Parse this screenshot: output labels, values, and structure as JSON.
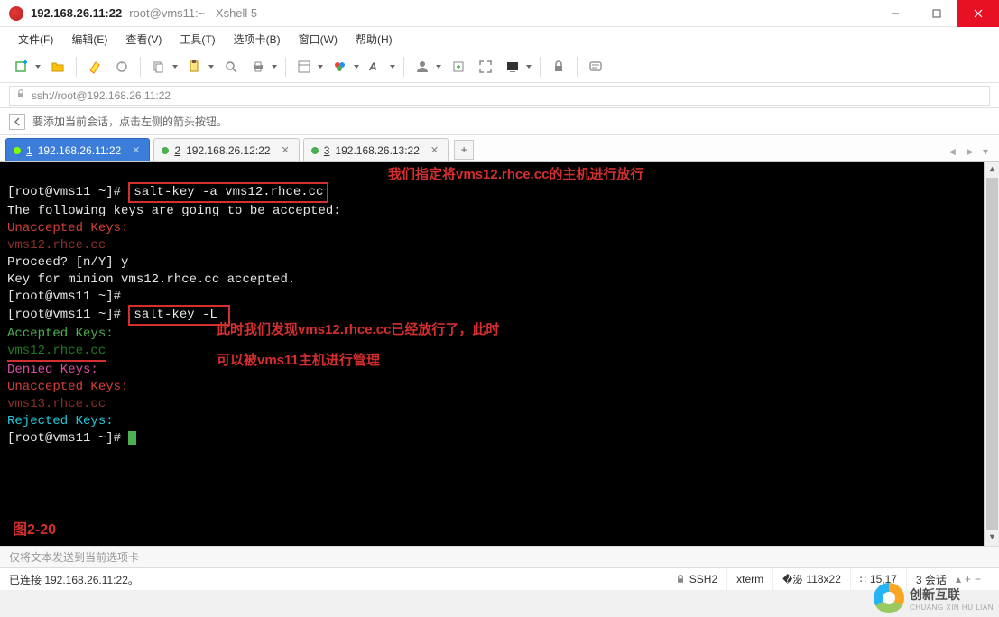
{
  "titlebar": {
    "host": "192.168.26.11:22",
    "session": "root@vms11:~ - Xshell 5"
  },
  "menu": {
    "file": "文件(F)",
    "edit": "编辑(E)",
    "view": "查看(V)",
    "tools": "工具(T)",
    "tab": "选项卡(B)",
    "window": "窗口(W)",
    "help": "帮助(H)"
  },
  "address": {
    "url": "ssh://root@192.168.26.11:22"
  },
  "hint": {
    "text": "要添加当前会话，点击左侧的箭头按钮。"
  },
  "tabs": {
    "t1_num": "1",
    "t1_label": "192.168.26.11:22",
    "t2_num": "2",
    "t2_label": "192.168.26.12:22",
    "t3_num": "3",
    "t3_label": "192.168.26.13:22"
  },
  "term": {
    "l1_prompt": "[root@vms11 ~]# ",
    "l1_cmd": "salt-key -a vms12.rhce.cc",
    "annot1": "我们指定将vms12.rhce.cc的主机进行放行",
    "l2": "The following keys are going to be accepted:",
    "l3": "Unaccepted Keys:",
    "l4": "vms12.rhce.cc",
    "l5": "Proceed? [n/Y] y",
    "l6": "Key for minion vms12.rhce.cc accepted.",
    "l7": "[root@vms11 ~]#",
    "l8_prompt": "[root@vms11 ~]# ",
    "l8_cmd": "salt-key -L ",
    "l9": "Accepted Keys:",
    "l10": "vms12.rhce.cc",
    "annot2a": "此时我们发现vms12.rhce.cc已经放行了，此时",
    "annot2b": "可以被vms11主机进行管理",
    "l11": "Denied Keys:",
    "l12": "Unaccepted Keys:",
    "l13": "vms13.rhce.cc",
    "l14": "Rejected Keys:",
    "l15": "[root@vms11 ~]# ",
    "fig": "图2-20"
  },
  "cmdbar": {
    "placeholder": "仅将文本发送到当前选项卡"
  },
  "status": {
    "conn": "已连接 192.168.26.11:22。",
    "proto": "SSH2",
    "term": "xterm",
    "size": "118x22",
    "pos": "15,17",
    "sess": "3 会话"
  },
  "watermark": {
    "text": "创新互联",
    "sub": "CHUANG XIN HU LIAN"
  }
}
